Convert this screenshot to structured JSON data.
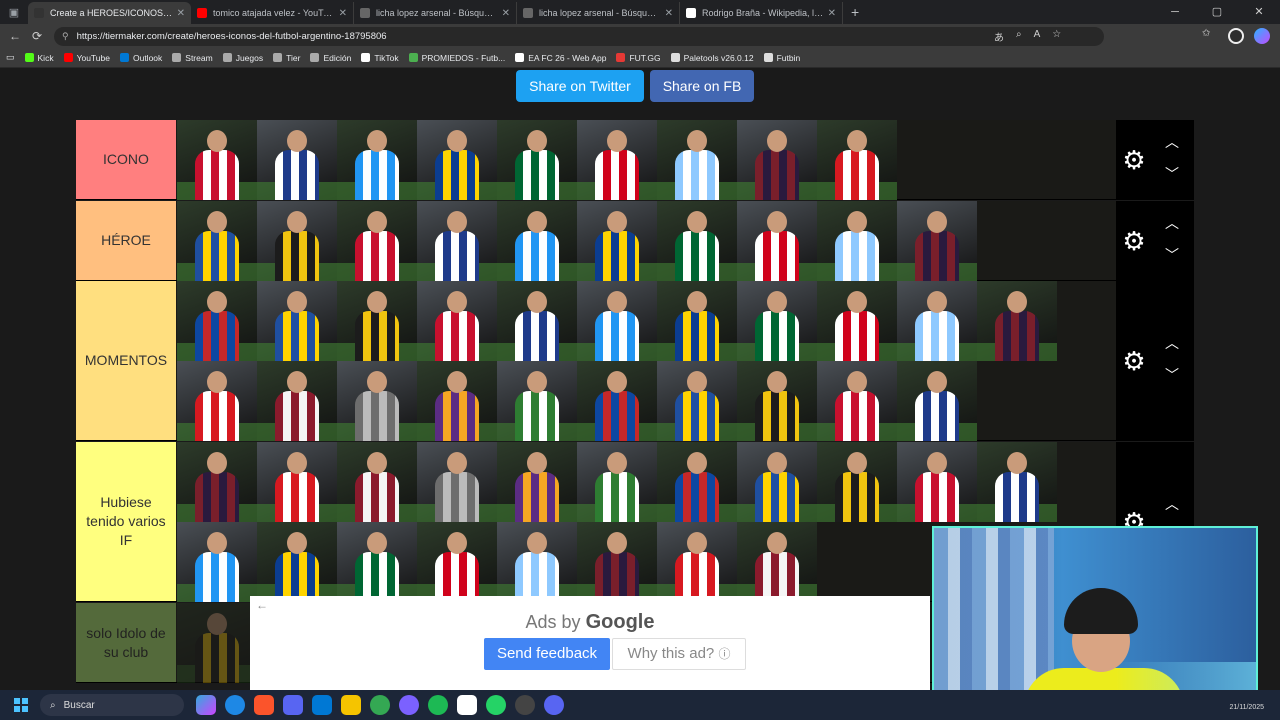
{
  "browser": {
    "tabs": [
      {
        "title": "Create a HEROES/ICONOS del FU",
        "active": true,
        "favicon_color": "#333333"
      },
      {
        "title": "tomico atajada velez - YouTube",
        "active": false,
        "favicon_color": "#ff0000"
      },
      {
        "title": "licha lopez arsenal - Búsqueda",
        "active": false,
        "favicon_color": "#666666"
      },
      {
        "title": "licha lopez arsenal - Búsqueda Im",
        "active": false,
        "favicon_color": "#666666"
      },
      {
        "title": "Rodrigo Braña - Wikipedia, la enc",
        "active": false,
        "favicon_color": "#ffffff"
      }
    ],
    "url": "https://tiermaker.com/create/heroes-iconos-del-futbol-argentino-18795806",
    "bookmarks": [
      {
        "label": "Kick",
        "color": "#53fc18"
      },
      {
        "label": "YouTube",
        "color": "#ff0000"
      },
      {
        "label": "Outlook",
        "color": "#0078d4"
      },
      {
        "label": "Stream",
        "color": "#aaaaaa"
      },
      {
        "label": "Juegos",
        "color": "#aaaaaa"
      },
      {
        "label": "Tier",
        "color": "#aaaaaa"
      },
      {
        "label": "Edición",
        "color": "#aaaaaa"
      },
      {
        "label": "TikTok",
        "color": "#ffffff"
      },
      {
        "label": "PROMIEDOS - Futb...",
        "color": "#4caf50"
      },
      {
        "label": "EA FC 26 - Web App",
        "color": "#ffffff"
      },
      {
        "label": "FUT.GG",
        "color": "#e53935"
      },
      {
        "label": "Paletools v26.0.12",
        "color": "#dddddd"
      },
      {
        "label": "Futbin",
        "color": "#dddddd"
      }
    ]
  },
  "share": {
    "twitter_label": "Share on Twitter",
    "fb_label": "Share on FB"
  },
  "tiers": [
    {
      "label": "ICONO",
      "color": "#ff7f7f",
      "count": 9
    },
    {
      "label": "HÉROE",
      "color": "#ffbf7f",
      "count": 10
    },
    {
      "label": "MOMENTOS",
      "color": "#ffdf7f",
      "count": 21
    },
    {
      "label": "Hubiese tenido varios IF",
      "color": "#ffff7f",
      "count": 19
    },
    {
      "label": "solo Idolo de su club",
      "color": "#bfff7f",
      "count": 1
    }
  ],
  "ad": {
    "ads_by": "Ads by",
    "google": "Google",
    "feedback": "Send feedback",
    "why": "Why this ad?"
  },
  "taskbar": {
    "search_placeholder": "Buscar",
    "date": "21/11/2025"
  },
  "colors": {
    "twitter": "#1da1f2",
    "facebook": "#4267b2",
    "page_bg": "#1a1a1a"
  }
}
